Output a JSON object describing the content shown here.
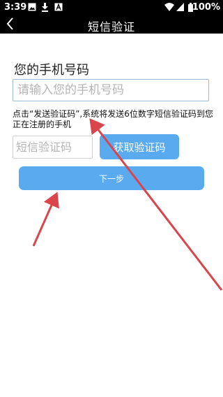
{
  "status_bar": {
    "time": "3:39",
    "battery_percent": "100%",
    "icons": [
      "image-icon",
      "download-icon",
      "a-icon",
      "wifi-icon",
      "signal-icon",
      "battery-icon"
    ]
  },
  "header": {
    "title": "短信验证",
    "back_icon": "chevron-left-icon"
  },
  "form": {
    "phone_label": "您的手机号码",
    "phone_placeholder": "请输入您的手机号码",
    "phone_value": "",
    "hint": "点击“发送验证码”,系统将发送6位数字短信验证码到您正在注册的手机",
    "code_placeholder": "短信验证码",
    "code_value": "",
    "get_code_label": "获取验证码",
    "next_label": "下一步"
  },
  "colors": {
    "primary_button": "#5aaaf0",
    "header_bg": "#000000",
    "annotation_arrow": "#d9454a"
  }
}
